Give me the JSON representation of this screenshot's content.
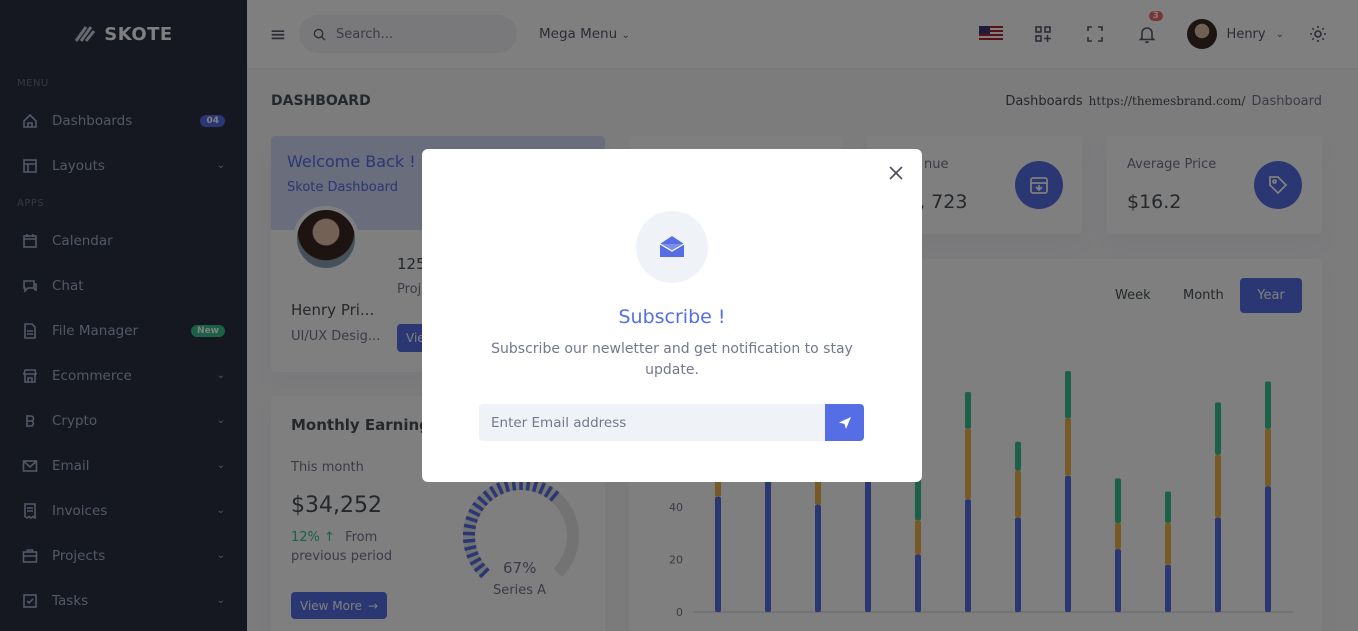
{
  "brand": {
    "name": "SKOTE"
  },
  "sidebar": {
    "section_menu": "MENU",
    "section_apps": "APPS",
    "items": [
      {
        "label": "Dashboards",
        "icon": "home-icon",
        "badge": "04"
      },
      {
        "label": "Layouts",
        "icon": "layout-icon"
      },
      {
        "label": "Calendar",
        "icon": "calendar-icon"
      },
      {
        "label": "Chat",
        "icon": "chat-icon"
      },
      {
        "label": "File Manager",
        "icon": "file-icon",
        "badge": "New"
      },
      {
        "label": "Ecommerce",
        "icon": "store-icon"
      },
      {
        "label": "Crypto",
        "icon": "bitcoin-icon"
      },
      {
        "label": "Email",
        "icon": "envelope-icon"
      },
      {
        "label": "Invoices",
        "icon": "receipt-icon"
      },
      {
        "label": "Projects",
        "icon": "briefcase-icon"
      },
      {
        "label": "Tasks",
        "icon": "task-icon"
      }
    ]
  },
  "topbar": {
    "search_placeholder": "Search...",
    "mega_menu": "Mega Menu",
    "notification_count": "3",
    "user_name": "Henry"
  },
  "page": {
    "title": "DASHBOARD",
    "breadcrumb": [
      "Dashboards",
      "https://themesbrand.com/",
      "Dashboard"
    ]
  },
  "welcome": {
    "title": "Welcome Back !",
    "subtitle": "Skote Dashboard",
    "name": "Henry Pri...",
    "role": "UI/UX Desig...",
    "projects_value": "125",
    "projects_label": "Proj",
    "view_button": "Vie"
  },
  "stats": [
    {
      "title": "nue",
      "value": "5, 723",
      "icon": "archive-icon"
    },
    {
      "title": "Average Price",
      "value": "$16.2",
      "icon": "tag-icon"
    }
  ],
  "monthly": {
    "title": "Monthly Earning",
    "this_month": "This month",
    "amount": "$34,252",
    "change": "12%",
    "change_text": "From",
    "change_text2": "previous period",
    "button": "View More",
    "gauge_value": "67%",
    "gauge_label": "Series A",
    "gauge_fraction": 0.67
  },
  "chart_tabs": [
    "Week",
    "Month",
    "Year"
  ],
  "chart_data": {
    "type": "bar",
    "stacked": true,
    "yticks": [
      "0",
      "20",
      "40"
    ],
    "series": [
      {
        "color": "#556ee6",
        "values": [
          44,
          55,
          41,
          67,
          22,
          43,
          36,
          52,
          24,
          18,
          36,
          48
        ]
      },
      {
        "color": "#f1b44c",
        "values": [
          13,
          23,
          20,
          8,
          13,
          27,
          18,
          22,
          10,
          16,
          24,
          22
        ]
      },
      {
        "color": "#34c38f",
        "values": [
          11,
          17,
          15,
          15,
          21,
          14,
          11,
          18,
          17,
          12,
          20,
          18
        ]
      }
    ]
  },
  "modal": {
    "title": "Subscribe !",
    "text": "Subscribe our newletter and get notification to stay update.",
    "input_placeholder": "Enter Email address"
  },
  "colors": {
    "primary": "#556ee6",
    "sidebar": "#2a3042",
    "success": "#34c38f",
    "warning": "#f1b44c"
  }
}
